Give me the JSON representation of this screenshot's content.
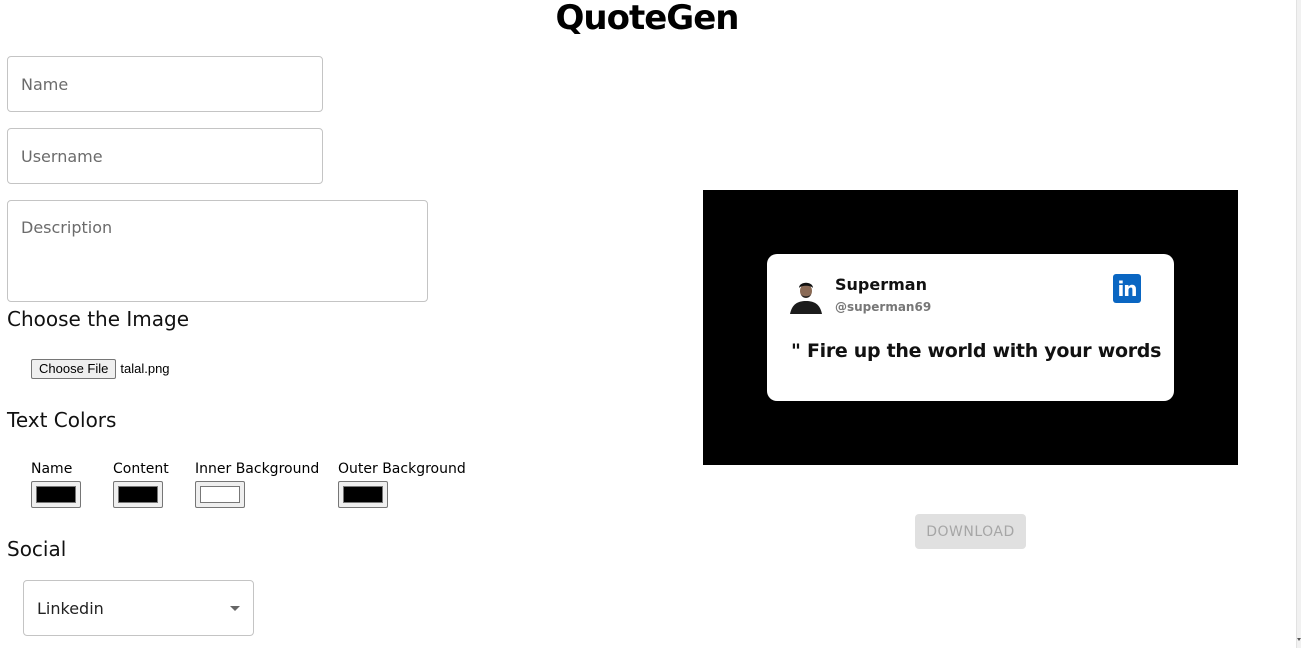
{
  "app": {
    "title": "QuoteGen"
  },
  "form": {
    "name_placeholder": "Name",
    "username_placeholder": "Username",
    "description_placeholder": "Description"
  },
  "image_section": {
    "heading": "Choose the Image",
    "choose_file_label": "Choose File",
    "file_name": "talal.png"
  },
  "colors_section": {
    "heading": "Text Colors",
    "items": [
      {
        "label": "Name",
        "value": "#000000"
      },
      {
        "label": "Content",
        "value": "#000000"
      },
      {
        "label": "Inner Background",
        "value": "#ffffff"
      },
      {
        "label": "Outer Background",
        "value": "#000000"
      }
    ]
  },
  "social_section": {
    "heading": "Social",
    "selected": "Linkedin"
  },
  "preview": {
    "name": "Superman",
    "username": "@superman69",
    "quote_mark": "\"",
    "quote": "Fire up the world with your words",
    "social_icon": "linkedin-icon",
    "social_icon_text": "in",
    "outer_bg": "#000000",
    "inner_bg": "#ffffff"
  },
  "actions": {
    "download_label": "DOWNLOAD"
  }
}
